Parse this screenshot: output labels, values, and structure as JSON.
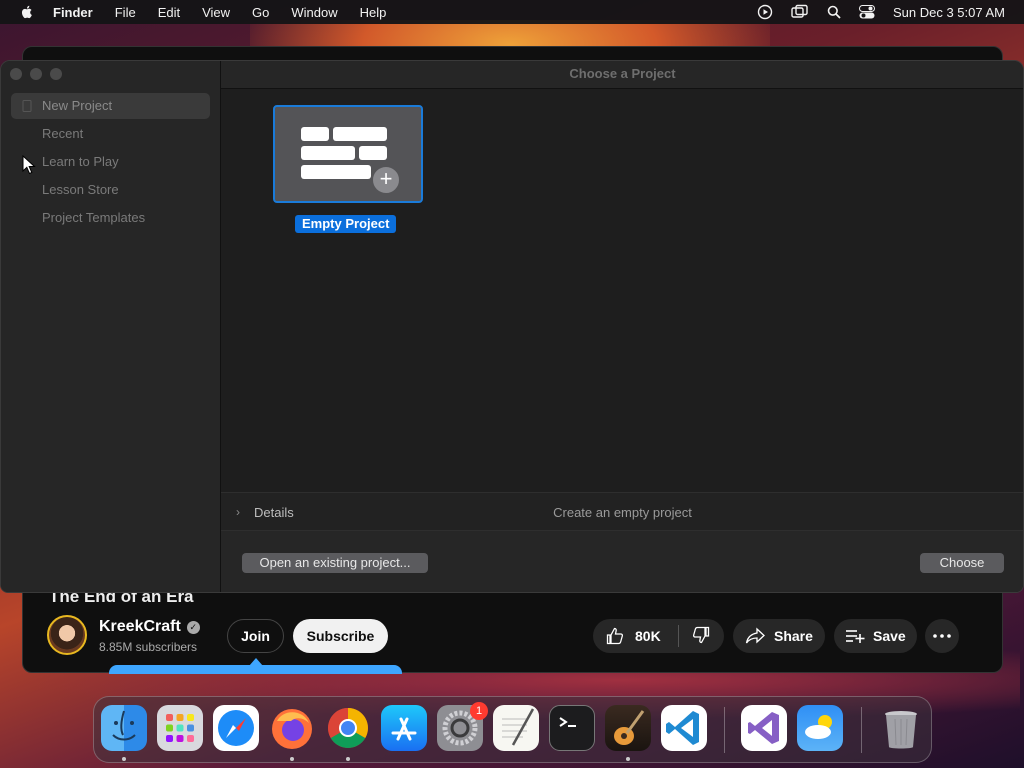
{
  "menubar": {
    "items": [
      "Finder",
      "File",
      "Edit",
      "View",
      "Go",
      "Window",
      "Help"
    ],
    "clock": "Sun Dec 3  5:07 AM"
  },
  "dialog": {
    "title": "Choose a Project",
    "sidebar": [
      "New Project",
      "Recent",
      "Learn to Play",
      "Lesson Store",
      "Project Templates"
    ],
    "selected_sidebar": "New Project",
    "project_label": "Empty Project",
    "details_label": "Details",
    "details_desc": "Create an empty project",
    "open_button": "Open an existing project...",
    "choose_button": "Choose"
  },
  "youtube": {
    "video_title": "The End of an Era",
    "channel": "KreekCraft",
    "subscribers": "8.85M subscribers",
    "join": "Join",
    "subscribe": "Subscribe",
    "likes": "80K",
    "share": "Share",
    "save": "Save"
  },
  "dock": {
    "apps": [
      "Finder",
      "Launchpad",
      "Safari",
      "Firefox",
      "Chrome",
      "App Store",
      "System Settings",
      "TextEdit",
      "Terminal",
      "GarageBand",
      "Visual Studio Code",
      "Visual Studio",
      "Weather",
      "Trash"
    ],
    "settings_badge": "1"
  },
  "colors": {
    "accent": "#0b6fdc",
    "selection_border": "#1a7bd9",
    "youtube_progress": "#3ea6ff"
  }
}
